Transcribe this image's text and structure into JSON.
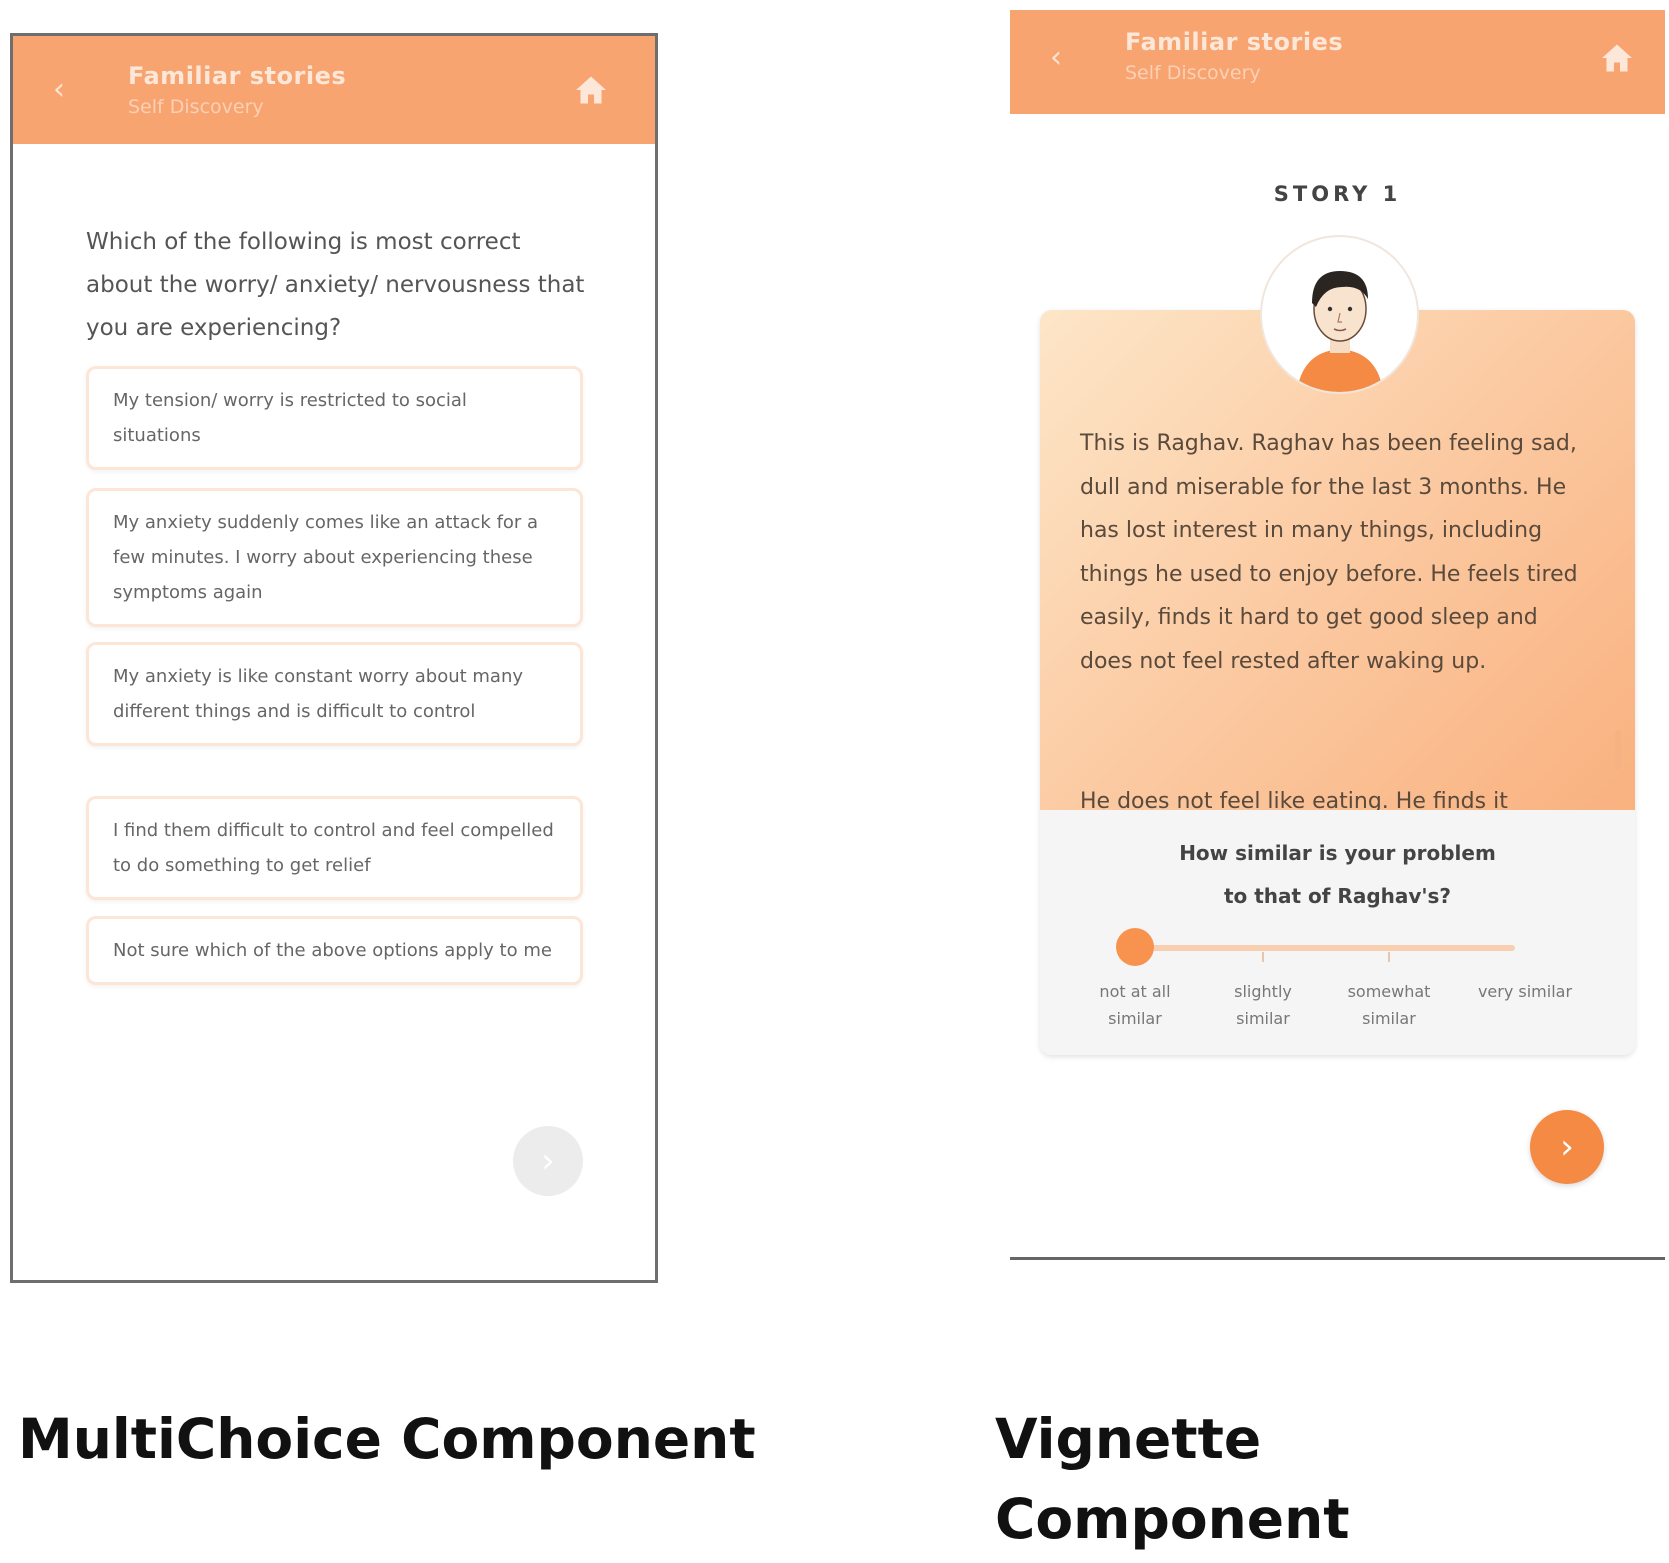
{
  "left_screen": {
    "header": {
      "title": "Familiar stories",
      "subtitle": "Self Discovery",
      "back_icon": "chevron-left-icon",
      "home_icon": "home-icon"
    },
    "question": "Which of the following is most correct about the worry/ anxiety/ nervousness that you are experiencing?",
    "options": [
      "My tension/ worry is restricted to social situations",
      "My anxiety suddenly comes like an attack for a few minutes. I worry about experiencing these symptoms again",
      "My anxiety is like constant worry about many different things and is difficult to control",
      "I find them difficult to control and feel compelled to do something to get relief",
      "Not sure which of the above options apply to me"
    ],
    "next_icon": "›"
  },
  "right_screen": {
    "header": {
      "title": "Familiar stories",
      "subtitle": "Self Discovery",
      "back_icon": "chevron-left-icon",
      "home_icon": "home-icon"
    },
    "story_label": "STORY 1",
    "story_text": "This is Raghav. Raghav has been feeling sad, dull and miserable for the last 3 months. He has lost interest in many things, including things he used to enjoy before. He feels tired easily, finds it hard to get good sleep and does not feel rested after waking up.",
    "story_text_more": "He does not feel like eating. He finds it",
    "similarity_question": "How similar is your problem to that of Raghav's?",
    "scale_labels": [
      "not at all similar",
      "slightly similar",
      "somewhat similar",
      "very similar"
    ],
    "slider_value_index": 0,
    "next_icon": "›"
  },
  "captions": {
    "left": "MultiChoice Component",
    "right_line1": "Vignette",
    "right_line2": "Component"
  },
  "colors": {
    "accent": "#f7a470",
    "accent_dark": "#f58a45",
    "disabled": "#ececec"
  }
}
